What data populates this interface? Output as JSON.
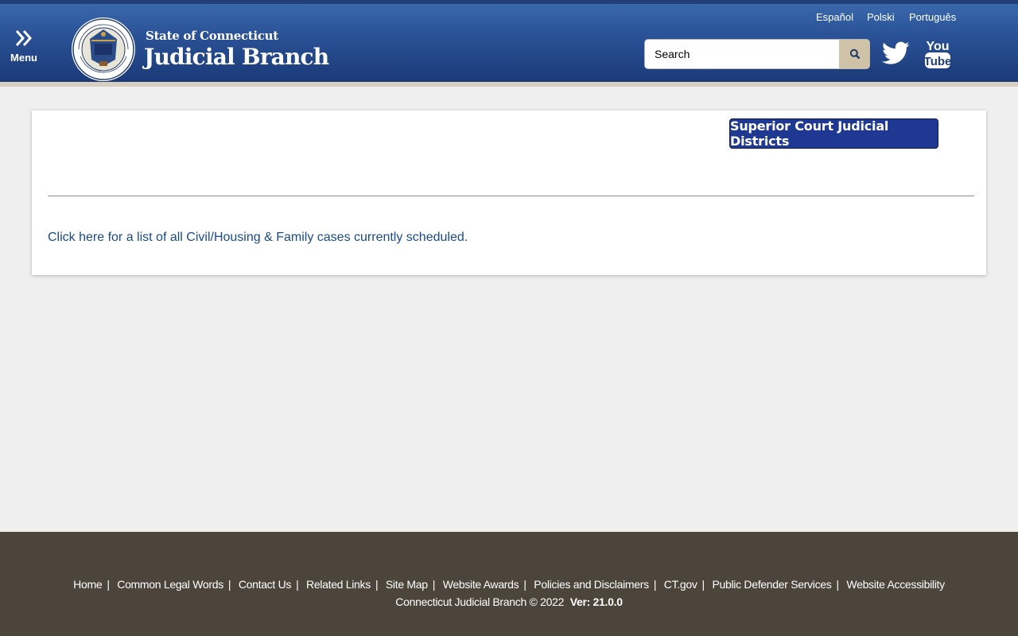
{
  "header": {
    "menu_label": "Menu",
    "brand_top": "State of Connecticut",
    "brand_main": "Judicial Branch",
    "languages": [
      "Español",
      "Polski",
      "Português"
    ],
    "search_placeholder": "Search",
    "icons": {
      "menu": "double-chevron-right-icon",
      "search": "search-icon",
      "twitter": "twitter-icon",
      "youtube": "youtube-icon"
    },
    "colors": {
      "header_blue": "#2a5296",
      "search_button": "#cfc2a6",
      "underline": "#d8cfbe"
    }
  },
  "content": {
    "districts_button": "Superior Court Judicial Districts",
    "cases_link": "Click here for a list of all Civil/Housing & Family cases currently scheduled."
  },
  "footer": {
    "links": [
      "Home",
      "Common Legal Words",
      "Contact Us",
      "Related Links",
      "Site Map",
      "Website Awards",
      "Policies and Disclaimers",
      "CT.gov",
      "Public Defender Services",
      "Website Accessibility"
    ],
    "copyright": "Connecticut Judicial Branch © 2022",
    "version": "Ver: 21.0.0",
    "colors": {
      "background": "#4c453b"
    }
  }
}
